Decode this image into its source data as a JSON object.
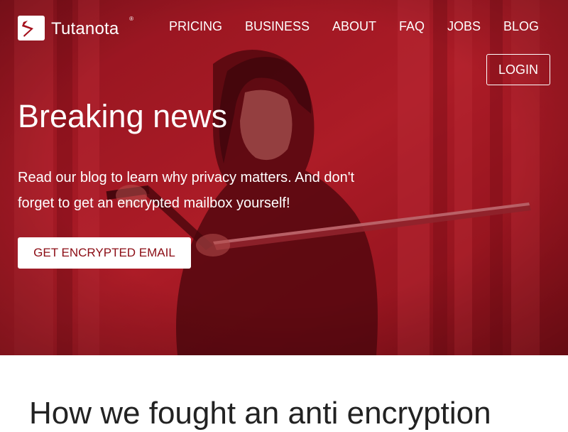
{
  "brand": {
    "name": "Tutanota",
    "registered_mark": "®",
    "logo_icon": "tutanota-logo-icon"
  },
  "nav": {
    "items": [
      {
        "label": "PRICING"
      },
      {
        "label": "BUSINESS"
      },
      {
        "label": "ABOUT"
      },
      {
        "label": "FAQ"
      },
      {
        "label": "JOBS"
      },
      {
        "label": "BLOG"
      }
    ],
    "login_label": "LOGIN"
  },
  "hero": {
    "title": "Breaking news",
    "text": "Read our blog to learn why privacy matters. And don't forget to get an encrypted mailbox yourself!",
    "cta_label": "GET ENCRYPTED EMAIL",
    "overlay_color": "#a4101c"
  },
  "article": {
    "heading": "How we fought an anti encryption"
  },
  "colors": {
    "accent": "#a4101c",
    "cta_text": "#8b0c14",
    "heading_text": "#222222"
  }
}
